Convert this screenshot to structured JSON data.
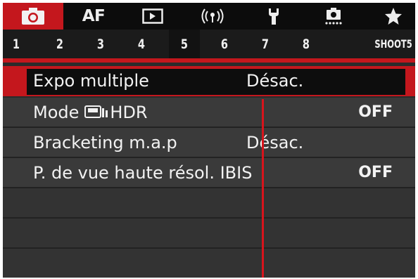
{
  "tabs": [
    {
      "id": "shoot",
      "icon": "camera-icon",
      "active": true
    },
    {
      "id": "af",
      "label": "AF"
    },
    {
      "id": "playback",
      "icon": "playback-icon"
    },
    {
      "id": "wireless",
      "icon": "wireless-icon"
    },
    {
      "id": "setup",
      "icon": "wrench-icon"
    },
    {
      "id": "custom",
      "icon": "custom-function-icon"
    },
    {
      "id": "mymenu",
      "icon": "star-icon"
    }
  ],
  "pages": [
    "1",
    "2",
    "3",
    "4",
    "5",
    "6",
    "7",
    "8",
    "SHOOT5"
  ],
  "active_page": "5",
  "menu": [
    {
      "label": "Expo multiple",
      "value": "Désac.",
      "selected": true
    },
    {
      "label_prefix": "Mode",
      "label_suffix": "HDR",
      "value": "OFF"
    },
    {
      "label": "Bracketing m.a.p",
      "value": "Désac."
    },
    {
      "label": "P. de vue haute résol. IBIS",
      "value": "OFF"
    }
  ],
  "colors": {
    "accent": "#c4171d",
    "background": "#2b2b2b",
    "row": "#3a3a3a",
    "tabbar": "#0c0c0c"
  }
}
